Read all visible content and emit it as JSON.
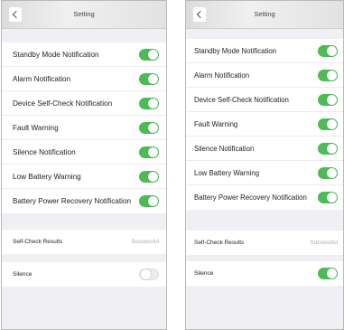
{
  "screens": [
    {
      "id": "left",
      "header": {
        "title": "Setting"
      },
      "notifications": [
        {
          "label": "Standby Mode Notification",
          "enabled": true
        },
        {
          "label": "Alarm Notification",
          "enabled": true
        },
        {
          "label": "Device Self-Check Notification",
          "enabled": true
        },
        {
          "label": "Fault Warning",
          "enabled": true
        },
        {
          "label": "Silence Notification",
          "enabled": true
        },
        {
          "label": "Low Battery Warning",
          "enabled": true
        },
        {
          "label": "Battery Power Recovery Notification",
          "enabled": true
        }
      ],
      "self_check": {
        "label": "Self-Check Results",
        "value": "Successful"
      },
      "silence": {
        "label": "Silence",
        "enabled": false
      }
    },
    {
      "id": "right",
      "header": {
        "title": "Setting"
      },
      "notifications": [
        {
          "label": "Standby Mode Notification",
          "enabled": true
        },
        {
          "label": "Alarm Notification",
          "enabled": true
        },
        {
          "label": "Device Self-Check Notification",
          "enabled": true
        },
        {
          "label": "Fault Warning",
          "enabled": true
        },
        {
          "label": "Silence Notification",
          "enabled": true
        },
        {
          "label": "Low Battery Warning",
          "enabled": true
        },
        {
          "label": "Battery Power Recovery Notification",
          "enabled": true
        }
      ],
      "self_check": {
        "label": "Self-Check Results",
        "value": "Successful"
      },
      "silence": {
        "label": "Silence",
        "enabled": true
      }
    }
  ],
  "colors": {
    "toggle_on": "#4cba57",
    "toggle_off": "#ebebeb",
    "background": "#efeff4"
  }
}
